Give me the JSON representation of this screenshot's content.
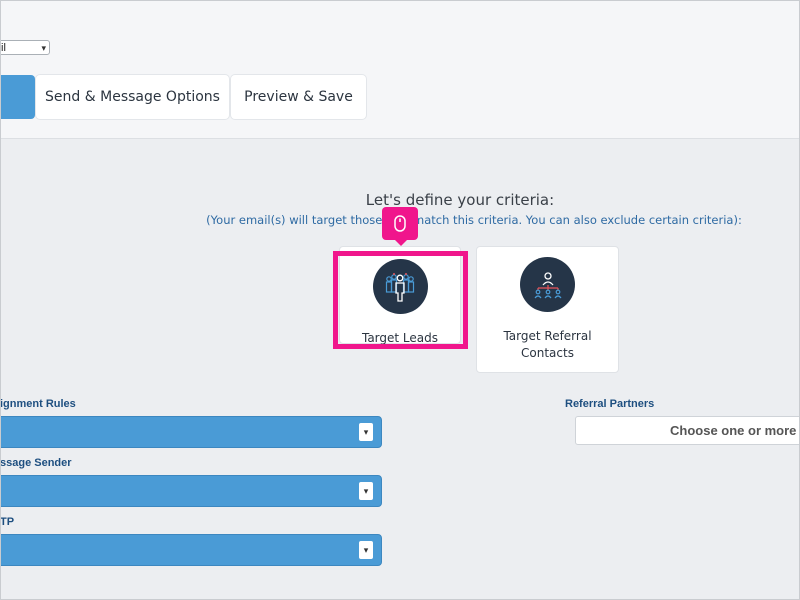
{
  "top": {
    "select_value": "il",
    "tabs": [
      {
        "label": ""
      },
      {
        "label": "Send & Message Options"
      },
      {
        "label": "Preview & Save"
      }
    ]
  },
  "criteria": {
    "title": "Let's define your criteria:",
    "subtitle": "(Your email(s) will target those that match this criteria. You can also exclude certain criteria):"
  },
  "cards": [
    {
      "label": "Target Leads",
      "icon": "group-leads-icon"
    },
    {
      "label": "Target Referral Contacts",
      "icon": "referral-network-icon"
    }
  ],
  "fields": {
    "assignment_rules": "ignment Rules",
    "message_sender": "ssage Sender",
    "smtp": "TP",
    "referral_partners": "Referral Partners",
    "referral_placeholder": "Choose one or more r"
  },
  "colors": {
    "accent_blue": "#4a9bd6",
    "highlight_pink": "#f0168c",
    "icon_bg": "#253548"
  }
}
